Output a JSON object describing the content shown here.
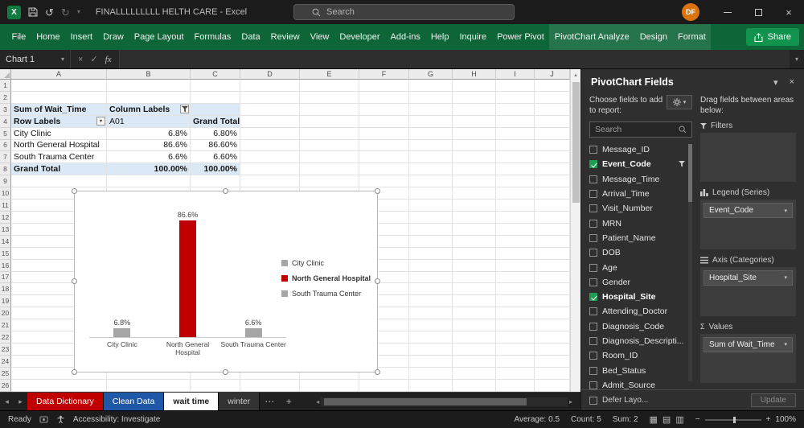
{
  "title_bar": {
    "title": "FINALLLLLLLLL HELTH CARE - Excel",
    "search_placeholder": "Search",
    "avatar": "DF"
  },
  "ribbon": {
    "tabs": [
      "File",
      "Home",
      "Insert",
      "Draw",
      "Page Layout",
      "Formulas",
      "Data",
      "Review",
      "View",
      "Developer",
      "Add-ins",
      "Help",
      "Inquire",
      "Power Pivot",
      "PivotChart Analyze",
      "Design",
      "Format"
    ],
    "context_tabs": [
      "PivotChart Analyze",
      "Design",
      "Format"
    ],
    "share_label": "Share"
  },
  "formula_bar": {
    "name_box": "Chart 1",
    "fx_label": "fx",
    "formula": ""
  },
  "grid": {
    "column_headers": [
      "A",
      "B",
      "C",
      "D",
      "E",
      "F",
      "G",
      "H",
      "I",
      "J"
    ],
    "row_count": 26,
    "cells": [
      {
        "r": 3,
        "c": 0,
        "text": "Sum of Wait_Time",
        "bold": true,
        "bg": true
      },
      {
        "r": 3,
        "c": 1,
        "text": "Column Labels",
        "bold": true,
        "bg": true,
        "icon": "filter"
      },
      {
        "r": 3,
        "c": 2,
        "text": "",
        "bg": true
      },
      {
        "r": 4,
        "c": 0,
        "text": "Row Labels",
        "bold": true,
        "bg": true,
        "icon": "dropdown"
      },
      {
        "r": 4,
        "c": 1,
        "text": "A01",
        "bg": true
      },
      {
        "r": 4,
        "c": 2,
        "text": "Grand Total",
        "bold": true,
        "bg": true
      },
      {
        "r": 5,
        "c": 0,
        "text": "City Clinic"
      },
      {
        "r": 5,
        "c": 1,
        "text": "6.8%",
        "align": "right"
      },
      {
        "r": 5,
        "c": 2,
        "text": "6.80%",
        "align": "right"
      },
      {
        "r": 6,
        "c": 0,
        "text": "North General Hospital"
      },
      {
        "r": 6,
        "c": 1,
        "text": "86.6%",
        "align": "right"
      },
      {
        "r": 6,
        "c": 2,
        "text": "86.60%",
        "align": "right"
      },
      {
        "r": 7,
        "c": 0,
        "text": "South Trauma Center"
      },
      {
        "r": 7,
        "c": 1,
        "text": "6.6%",
        "align": "right"
      },
      {
        "r": 7,
        "c": 2,
        "text": "6.60%",
        "align": "right"
      },
      {
        "r": 8,
        "c": 0,
        "text": "Grand Total",
        "bold": true,
        "bg": true
      },
      {
        "r": 8,
        "c": 1,
        "text": "100.00%",
        "bold": true,
        "bg": true,
        "align": "right"
      },
      {
        "r": 8,
        "c": 2,
        "text": "100.00%",
        "bold": true,
        "bg": true,
        "align": "right"
      }
    ]
  },
  "chart_data": {
    "type": "bar",
    "title": "",
    "categories": [
      "City Clinic",
      "North General Hospital",
      "South Trauma Center"
    ],
    "values": [
      6.8,
      86.6,
      6.6
    ],
    "data_labels": [
      "6.8%",
      "86.6%",
      "6.6%"
    ],
    "bar_colors": [
      "#a6a6a6",
      "#c00000",
      "#a6a6a6"
    ],
    "ylim": [
      0,
      100
    ],
    "grid": false,
    "legend_position": "right",
    "legend": [
      {
        "label": "City Clinic",
        "color": "#a6a6a6",
        "bold": false
      },
      {
        "label": "North General Hospital",
        "color": "#c00000",
        "bold": true
      },
      {
        "label": "South Trauma Center",
        "color": "#a6a6a6",
        "bold": false
      }
    ]
  },
  "fields_panel": {
    "title": "PivotChart Fields",
    "choose_label": "Choose fields to add to report:",
    "search_placeholder": "Search",
    "drag_label": "Drag fields between areas below:",
    "fields": [
      {
        "name": "Message_ID",
        "checked": false
      },
      {
        "name": "Event_Code",
        "checked": true,
        "filtered": true
      },
      {
        "name": "Message_Time",
        "checked": false
      },
      {
        "name": "Arrival_Time",
        "checked": false
      },
      {
        "name": "Visit_Number",
        "checked": false
      },
      {
        "name": "MRN",
        "checked": false
      },
      {
        "name": "Patient_Name",
        "checked": false
      },
      {
        "name": "DOB",
        "checked": false
      },
      {
        "name": "Age",
        "checked": false
      },
      {
        "name": "Gender",
        "checked": false
      },
      {
        "name": "Hospital_Site",
        "checked": true
      },
      {
        "name": "Attending_Doctor",
        "checked": false
      },
      {
        "name": "Diagnosis_Code",
        "checked": false
      },
      {
        "name": "Diagnosis_Descripti...",
        "checked": false
      },
      {
        "name": "Room_ID",
        "checked": false
      },
      {
        "name": "Bed_Status",
        "checked": false
      },
      {
        "name": "Admit_Source",
        "checked": false
      }
    ],
    "areas": [
      {
        "icon": "filter",
        "label": "Filters",
        "items": []
      },
      {
        "icon": "series",
        "label": "Legend (Series)",
        "items": [
          "Event_Code"
        ]
      },
      {
        "icon": "axis",
        "label": "Axis (Categories)",
        "items": [
          "Hospital_Site"
        ]
      },
      {
        "icon": "sigma",
        "label": "Values",
        "items": [
          "Sum of Wait_Time"
        ]
      }
    ],
    "defer_label": "Defer Layo...",
    "update_label": "Update"
  },
  "sheet_tabs": {
    "tabs": [
      {
        "name": "Data Dictionary",
        "bg": "#c00000",
        "fg": "#ffffff",
        "active": false
      },
      {
        "name": "Clean Data",
        "bg": "#2058a8",
        "fg": "#ffffff",
        "active": false
      },
      {
        "name": "wait time",
        "bg": "#ffffff",
        "fg": "#1a1a1a",
        "active": true
      },
      {
        "name": "winter",
        "bg": "#333333",
        "fg": "#cccccc",
        "active": false
      }
    ]
  },
  "status_bar": {
    "mode": "Ready",
    "accessibility": "Accessibility: Investigate",
    "aggregates": {
      "average": "Average: 0.5",
      "count": "Count: 5",
      "sum": "Sum: 2"
    },
    "zoom": "100%"
  },
  "colors": {
    "ribbon_green": "#0e6537",
    "share_green": "#12934d",
    "pivot_fill": "#dbe9f7",
    "bar_red": "#c00000",
    "bar_gray": "#a6a6a6",
    "checked_green": "#1f9d55",
    "avatar_orange": "#d9730d"
  }
}
